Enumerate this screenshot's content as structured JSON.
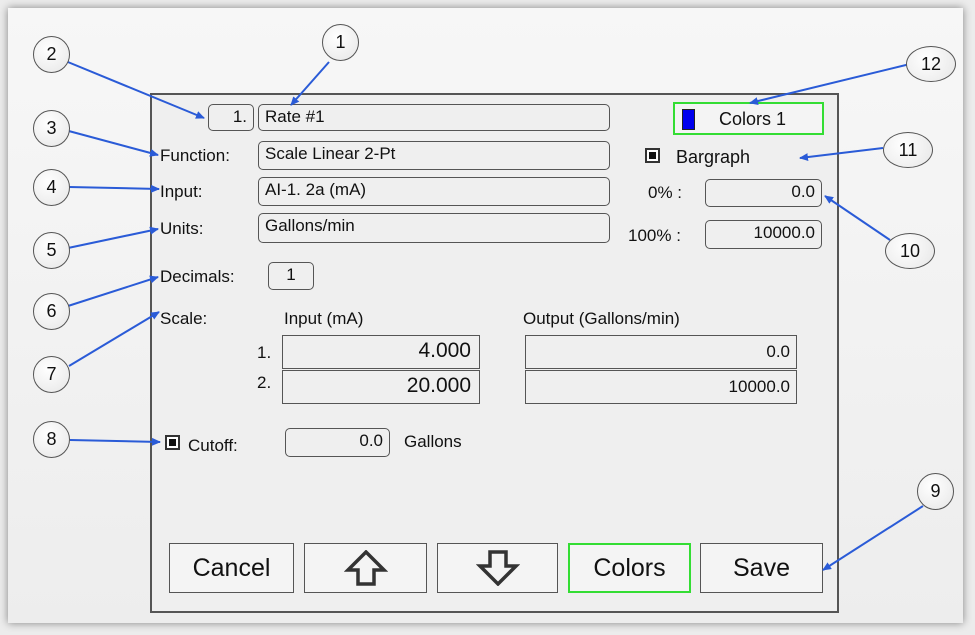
{
  "header": {
    "index_label": "1.",
    "name_value": "Rate #1",
    "colors_indicator_label": "Colors 1",
    "colors_swatch_color": "#0000ee"
  },
  "function": {
    "label": "Function:",
    "value": "Scale Linear 2-Pt"
  },
  "input": {
    "label": "Input:",
    "value": "AI-1. 2a (mA)"
  },
  "units": {
    "label": "Units:",
    "value": "Gallons/min"
  },
  "bargraph": {
    "label": "Bargraph",
    "checked": true,
    "zero_label": "0% :",
    "zero_value": "0.0",
    "full_label": "100% :",
    "full_value": "10000.0"
  },
  "decimals": {
    "label": "Decimals:",
    "value": "1"
  },
  "scale": {
    "label": "Scale:",
    "input_header": "Input (mA)",
    "output_header": "Output (Gallons/min)",
    "rows": [
      {
        "num": "1.",
        "input": "4.000",
        "output": "0.0"
      },
      {
        "num": "2.",
        "input": "20.000",
        "output": "10000.0"
      }
    ]
  },
  "cutoff": {
    "label": "Cutoff:",
    "checked": true,
    "value": "0.0",
    "unit": "Gallons"
  },
  "buttons": {
    "cancel": "Cancel",
    "up_icon": "up-arrow-icon",
    "down_icon": "down-arrow-icon",
    "colors": "Colors",
    "save": "Save"
  },
  "callouts": [
    "1",
    "2",
    "3",
    "4",
    "5",
    "6",
    "7",
    "8",
    "9",
    "10",
    "11",
    "12"
  ],
  "accent_colors": {
    "leader_line": "#2a5bd7",
    "active_outline": "#33dd33"
  }
}
